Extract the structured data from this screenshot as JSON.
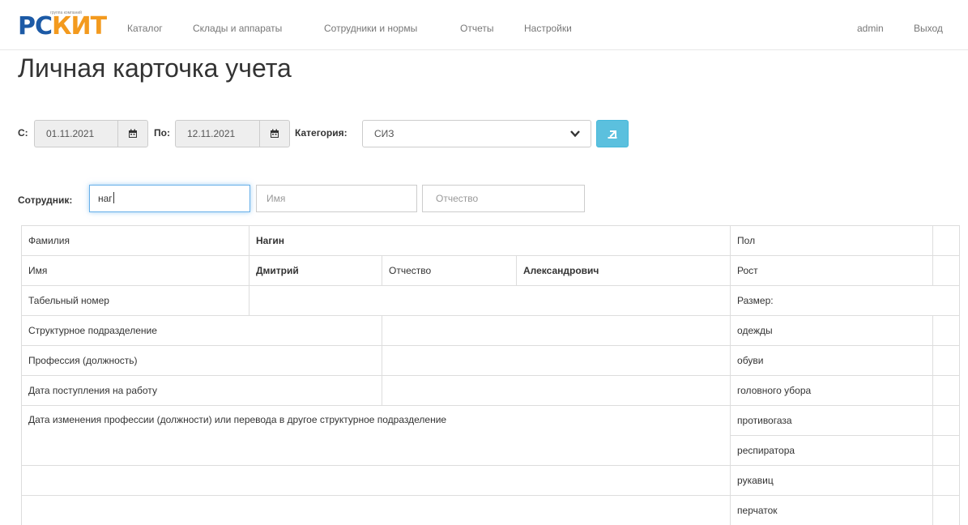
{
  "app": {
    "logo": {
      "part1": "РС",
      "part2": "КИТ",
      "tagline": "группа компаний"
    }
  },
  "nav": {
    "items": [
      "Каталог",
      "Склады и аппараты",
      "Сотрудники и нормы",
      "Отчеты",
      "Настройки"
    ],
    "user": "admin",
    "logout": "Выход"
  },
  "page": {
    "title": "Личная карточка учета"
  },
  "filters": {
    "from_label": "С:",
    "from_value": "01.11.2021",
    "to_label": "По:",
    "to_value": "12.11.2021",
    "category_label": "Категория:",
    "category_value": "СИЗ"
  },
  "employee": {
    "label": "Сотрудник:",
    "surname_value": "наг",
    "name_placeholder": "Имя",
    "patronymic_placeholder": "Отчество"
  },
  "card": {
    "surname_label": "Фамилия",
    "surname": "Нагин",
    "gender_label": "Пол",
    "name_label": "Имя",
    "name": "Дмитрий",
    "patronymic_label": "Отчество",
    "patronymic": "Александрович",
    "height_label": "Рост",
    "tab_label": "Табельный номер",
    "size_label": "Размер:",
    "division_label": "Структурное подразделение",
    "clothes_label": "одежды",
    "profession_label": "Профессия (должность)",
    "shoes_label": "обуви",
    "hire_date_label": "Дата поступления на работу",
    "headwear_label": "головного убора",
    "change_label": "Дата изменения профессии (должности) или перевода в другое структурное подразделение",
    "gasmask_label": "противогаза",
    "respirator_label": "респиратора",
    "mittens_label": "рукавиц",
    "gloves_label": "перчаток"
  },
  "colors": {
    "accent": "#5bc0de",
    "logo_blue": "#1c5aa6",
    "logo_orange": "#f39a1e"
  }
}
